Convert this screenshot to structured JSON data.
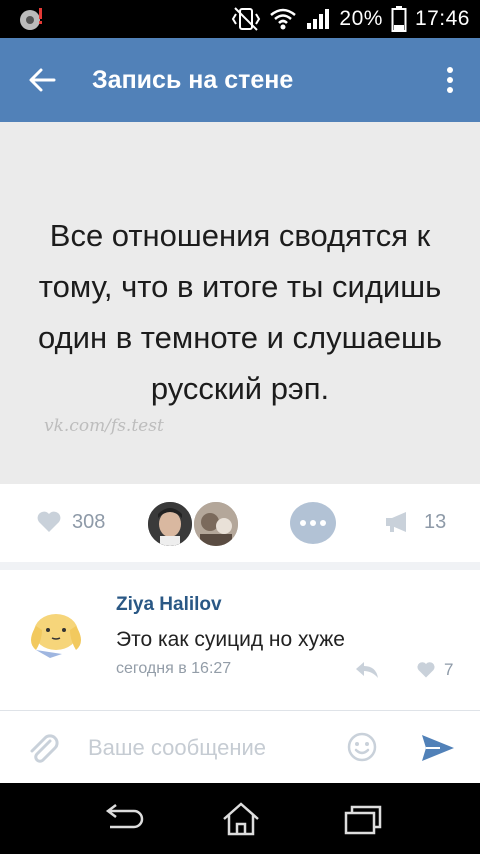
{
  "status_bar": {
    "battery": "20%",
    "time": "17:46"
  },
  "app_bar": {
    "title": "Запись на стене"
  },
  "post": {
    "image_text": "Все отношения сводятся к тому, что в итоге ты сидишь один в темноте и слушаешь русский рэп.",
    "watermark": "vk.com/fs.test"
  },
  "actions": {
    "likes": "308",
    "shares": "13"
  },
  "comment": {
    "author": "Ziya Halilov",
    "text": "Это как суицид но хуже",
    "time": "сегодня в 16:27",
    "likes": "7"
  },
  "input": {
    "placeholder": "Ваше сообщение"
  },
  "colors": {
    "header": "#5181b8",
    "author_link": "#2a5885",
    "send": "#5181b8",
    "muted": "#8e9aa8"
  }
}
